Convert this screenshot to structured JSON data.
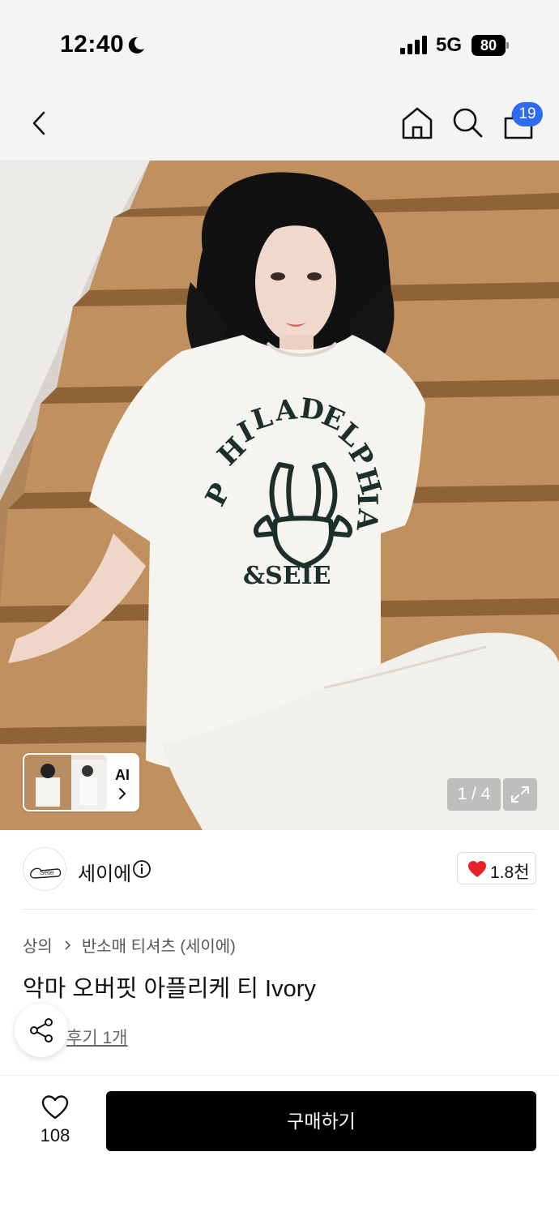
{
  "status_bar": {
    "time": "12:40",
    "network": "5G",
    "battery": "80",
    "icons": [
      "moon-icon",
      "signal-icon",
      "battery-icon"
    ]
  },
  "header": {
    "icons": [
      "chevron-left-icon",
      "home-icon",
      "search-icon",
      "shopping-bag-icon"
    ],
    "cart_badge": "19"
  },
  "gallery": {
    "ai_label": "AI",
    "page_indicator": "1 / 4",
    "expand_icon": "expand-icon"
  },
  "brand": {
    "name": "세이에",
    "likes": "1.8천",
    "logo_text": "Seie",
    "icons": [
      "info-icon",
      "heart-filled-icon"
    ]
  },
  "product": {
    "breadcrumb": [
      "상의",
      "반소매 티셔츠 (세이에)"
    ],
    "title": "악마 오버핏 아플리케 티 Ivory",
    "review_link": "후기 1개"
  },
  "share": {
    "icon": "share-icon"
  },
  "bottom_bar": {
    "wishlist_count": "108",
    "buy_label": "구매하기",
    "icons": [
      "heart-outline-icon"
    ]
  },
  "colors": {
    "accent_blue": "#2e6bf0",
    "heart_red": "#e8212b",
    "buy_button": "#000000",
    "header_bg": "#f4f4f4"
  }
}
